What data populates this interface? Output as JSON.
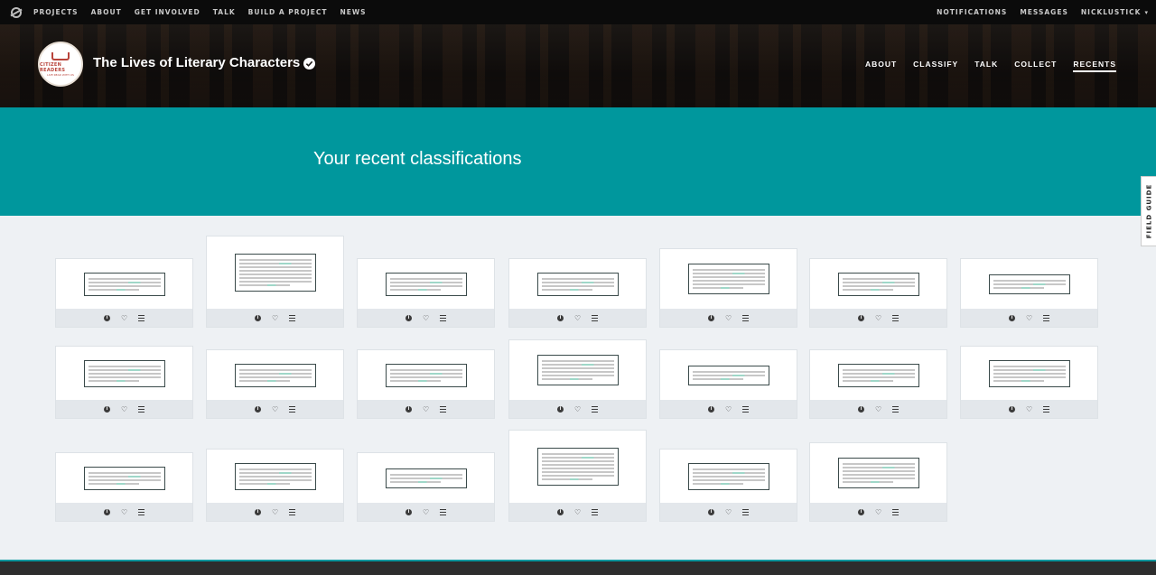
{
  "topnav": {
    "links": [
      "PROJECTS",
      "ABOUT",
      "GET INVOLVED",
      "TALK",
      "BUILD A PROJECT",
      "NEWS"
    ],
    "notifications": "NOTIFICATIONS",
    "messages": "MESSAGES",
    "user": "NICKLUSTICK"
  },
  "project": {
    "title": "The Lives of Literary Characters",
    "avatar_brand": "CITIZEN READERS",
    "avatar_sub": "LIVE READ WITH US",
    "nav": [
      "ABOUT",
      "CLASSIFY",
      "TALK",
      "COLLECT",
      "RECENTS"
    ],
    "active_nav": "RECENTS"
  },
  "banner": {
    "title": "Your recent classifications"
  },
  "field_guide": "FIELD GUIDE",
  "cards": [
    {
      "lines": 4
    },
    {
      "lines": 8
    },
    {
      "lines": 4
    },
    {
      "lines": 4
    },
    {
      "lines": 6
    },
    {
      "lines": 4
    },
    {
      "lines": 3
    },
    {
      "lines": 5
    },
    {
      "lines": 4
    },
    {
      "lines": 4
    },
    {
      "lines": 6
    },
    {
      "lines": 3
    },
    {
      "lines": 4
    },
    {
      "lines": 5
    },
    {
      "lines": 4
    },
    {
      "lines": 5
    },
    {
      "lines": 3
    },
    {
      "lines": 8
    },
    {
      "lines": 5
    },
    {
      "lines": 6
    }
  ]
}
